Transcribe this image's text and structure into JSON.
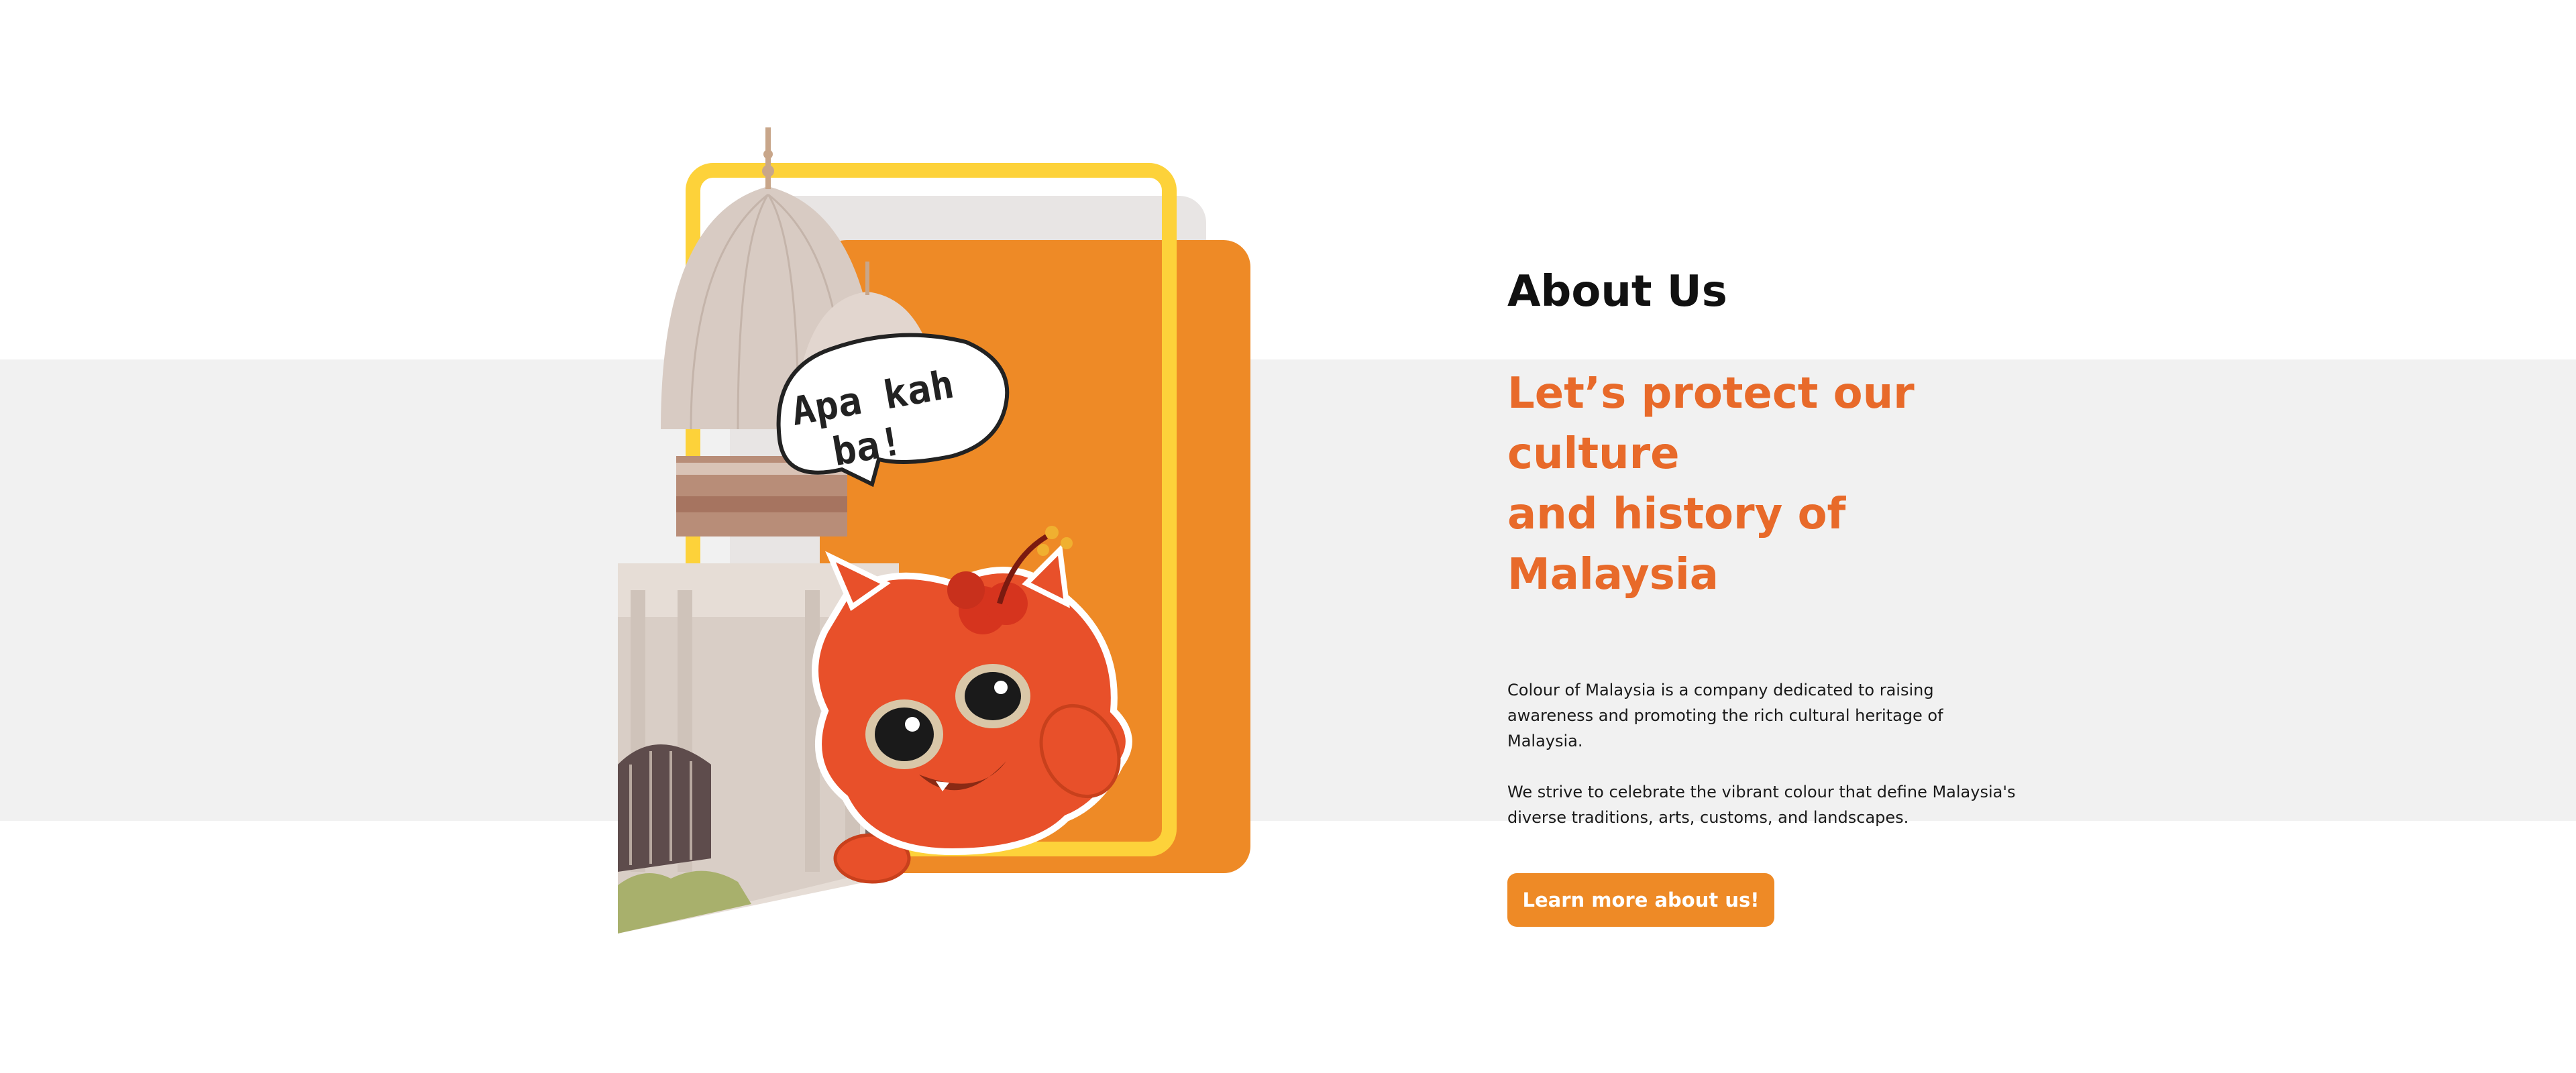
{
  "about": {
    "heading": "About Us",
    "tagline_line1": "Let’s protect our culture",
    "tagline_line2": "and history of Malaysia",
    "paragraph1": "Colour of Malaysia is a company dedicated to raising awareness and promoting the rich cultural heritage of Malaysia.",
    "paragraph2": "We strive to celebrate the vibrant colour that define Malaysia's diverse traditions, arts, customs, and landscapes.",
    "cta_label": "Learn more about us!"
  },
  "illustration": {
    "speech_bubble_line1": "Apa kah",
    "speech_bubble_line2": "ba!",
    "mascot": "red-cat-mascot-with-hibiscus",
    "building": "mosque-dome-building"
  },
  "colors": {
    "accent_orange": "#ee8a26",
    "tagline_orange": "#e86a2a",
    "frame_yellow": "#fdd23a",
    "band_gray": "#f1f1f1"
  }
}
